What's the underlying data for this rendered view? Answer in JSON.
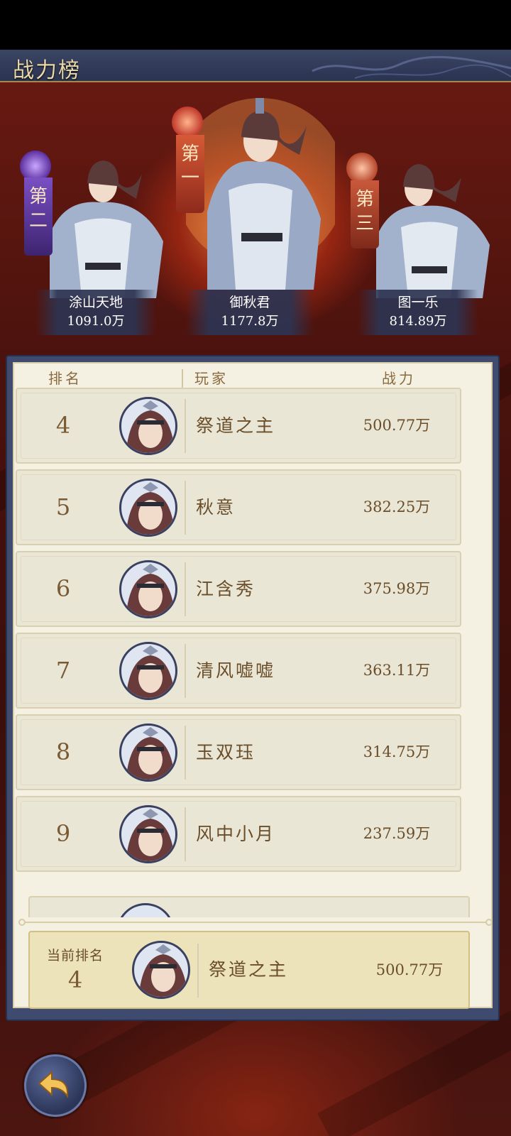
{
  "title": "战力榜",
  "top3": [
    {
      "rank_label": "第二",
      "name": "涂山天地",
      "power": "1091.0万",
      "accent": "#7a4fc4"
    },
    {
      "rank_label": "第一",
      "name": "御秋君",
      "power": "1177.8万",
      "accent": "#c0392b"
    },
    {
      "rank_label": "第三",
      "name": "图一乐",
      "power": "814.89万",
      "accent": "#b5462a"
    }
  ],
  "columns": {
    "rank": "排名",
    "player": "玩家",
    "power": "战力"
  },
  "rows": [
    {
      "rank": "4",
      "name": "祭道之主",
      "power": "500.77万"
    },
    {
      "rank": "5",
      "name": "秋意",
      "power": "382.25万"
    },
    {
      "rank": "6",
      "name": "江含秀",
      "power": "375.98万"
    },
    {
      "rank": "7",
      "name": "清风嘘嘘",
      "power": "363.11万"
    },
    {
      "rank": "8",
      "name": "玉双珏",
      "power": "314.75万"
    },
    {
      "rank": "9",
      "name": "风中小月",
      "power": "237.59万"
    }
  ],
  "current": {
    "label": "当前排名",
    "rank": "4",
    "name": "祭道之主",
    "power": "500.77万"
  },
  "colors": {
    "panel": "#f4f0e2",
    "text": "#6a4e2a",
    "frame": "#3e4a6e"
  }
}
